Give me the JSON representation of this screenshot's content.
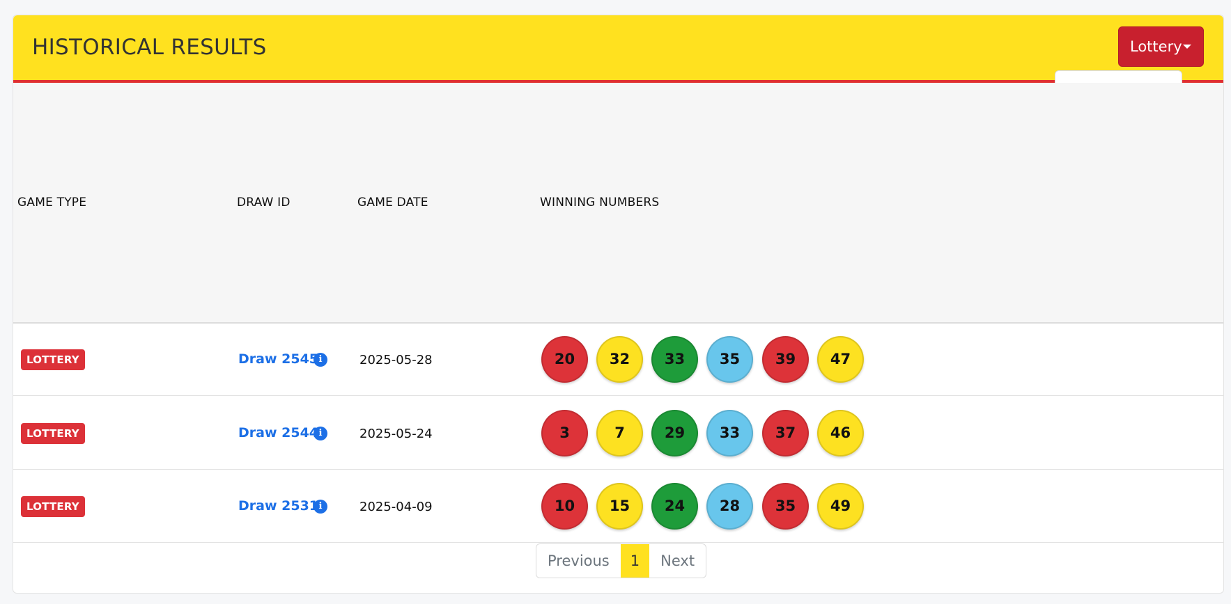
{
  "header": {
    "title": "HISTORICAL RESULTS",
    "dropdown_label": "Lottery"
  },
  "table": {
    "columns": [
      "GAME TYPE",
      "DRAW ID",
      "GAME DATE",
      "WINNING NUMBERS"
    ],
    "rows": [
      {
        "game_type": "LOTTERY",
        "draw": "Draw 2545",
        "date": "2025-05-28",
        "numbers": [
          "20",
          "32",
          "33",
          "35",
          "39",
          "47"
        ]
      },
      {
        "game_type": "LOTTERY",
        "draw": "Draw 2544",
        "date": "2025-05-24",
        "numbers": [
          "3",
          "7",
          "29",
          "33",
          "37",
          "46"
        ]
      },
      {
        "game_type": "LOTTERY",
        "draw": "Draw 2531",
        "date": "2025-04-09",
        "numbers": [
          "10",
          "15",
          "24",
          "28",
          "35",
          "49"
        ]
      }
    ],
    "ball_colors": [
      "red",
      "yellow",
      "green",
      "blue",
      "red",
      "yellow"
    ]
  },
  "pagination": {
    "previous": "Previous",
    "current": "1",
    "next": "Next"
  },
  "colors": {
    "header_bg": "#ffe11f",
    "accent_red": "#c8202e",
    "link_blue": "#1c6fe6"
  }
}
